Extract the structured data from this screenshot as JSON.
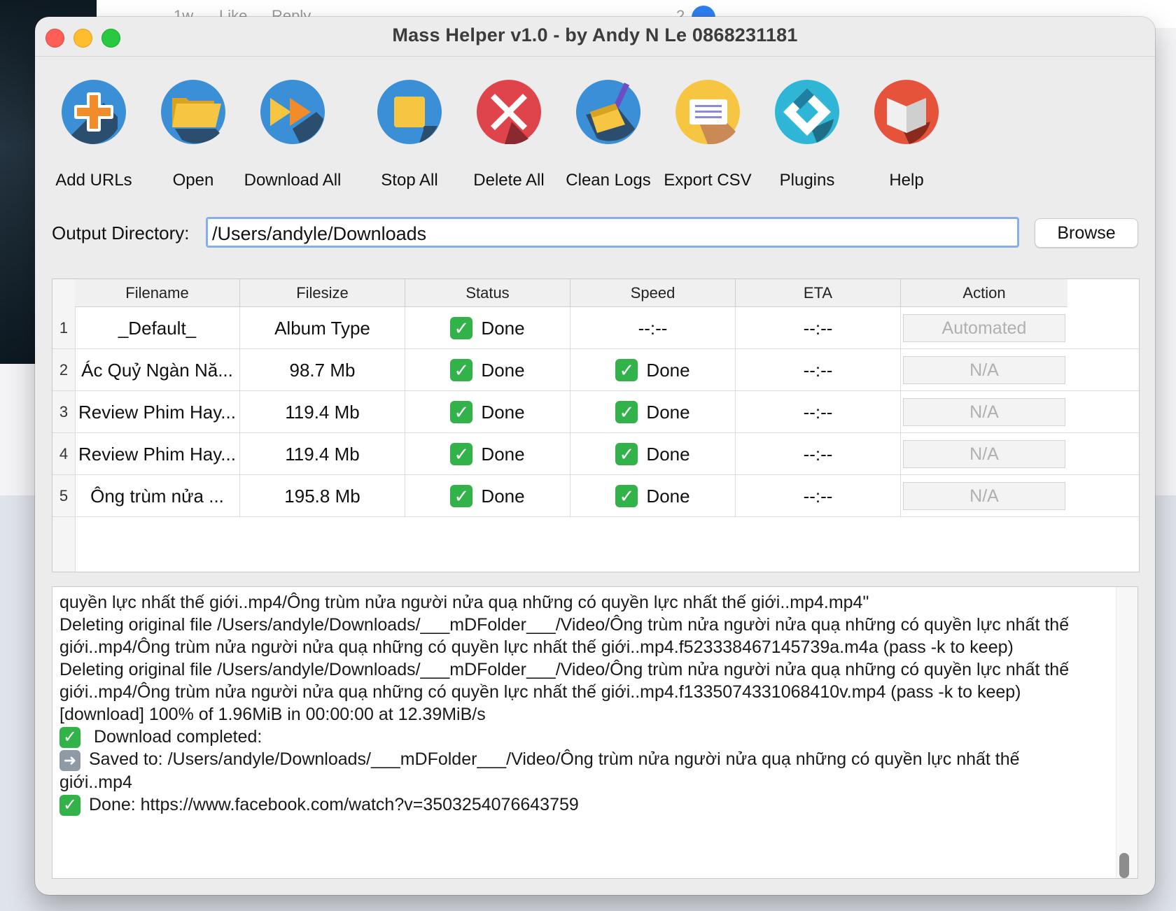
{
  "background": {
    "strip_texts": [
      "1w",
      "Like",
      "Reply",
      "2"
    ]
  },
  "window": {
    "title": "Mass Helper v1.0 - by Andy N Le 0868231181"
  },
  "toolbar": {
    "buttons": [
      {
        "label": "Add URLs",
        "icon": "add-urls-icon"
      },
      {
        "label": "Open",
        "icon": "folder-icon"
      },
      {
        "label": "Download All",
        "icon": "fast-forward-icon"
      },
      {
        "label": "Stop All",
        "icon": "stop-icon"
      },
      {
        "label": "Delete All",
        "icon": "delete-x-icon"
      },
      {
        "label": "Clean Logs",
        "icon": "broom-dustpan-icon"
      },
      {
        "label": "Export CSV",
        "icon": "document-icon"
      },
      {
        "label": "Plugins",
        "icon": "plugin-diamond-icon"
      },
      {
        "label": "Help",
        "icon": "help-book-icon"
      }
    ]
  },
  "output": {
    "label": "Output Directory:",
    "value": "/Users/andyle/Downloads",
    "browse_label": "Browse"
  },
  "table": {
    "headers": [
      "Filename",
      "Filesize",
      "Status",
      "Speed",
      "ETA",
      "Action"
    ],
    "rows": [
      {
        "num": "1",
        "filename": "_Default_",
        "filesize": "Album Type",
        "status": "Done",
        "speed": "--:--",
        "speed_done": false,
        "eta": "--:--",
        "action": "Automated"
      },
      {
        "num": "2",
        "filename": "Ác Quỷ Ngàn Nă...",
        "filesize": "98.7 Mb",
        "status": "Done",
        "speed": "Done",
        "speed_done": true,
        "eta": "--:--",
        "action": "N/A"
      },
      {
        "num": "3",
        "filename": "Review Phim Hay...",
        "filesize": "119.4 Mb",
        "status": "Done",
        "speed": "Done",
        "speed_done": true,
        "eta": "--:--",
        "action": "N/A"
      },
      {
        "num": "4",
        "filename": "Review Phim Hay...",
        "filesize": "119.4 Mb",
        "status": "Done",
        "speed": "Done",
        "speed_done": true,
        "eta": "--:--",
        "action": "N/A"
      },
      {
        "num": "5",
        "filename": "Ông trùm nửa ...",
        "filesize": "195.8 Mb",
        "status": "Done",
        "speed": "Done",
        "speed_done": true,
        "eta": "--:--",
        "action": "N/A"
      }
    ]
  },
  "log": {
    "lines": [
      {
        "text": "quyền lực nhất thế giới..mp4/Ông trùm nửa người nửa quạ những có quyền lực nhất thế giới..mp4.mp4\"",
        "prefix": ""
      },
      {
        "text": "Deleting original file /Users/andyle/Downloads/___mDFolder___/Video/Ông trùm nửa người nửa quạ những có quyền lực nhất thế giới..mp4/Ông trùm nửa người nửa quạ những có quyền lực nhất thế giới..mp4.f523338467145739a.m4a (pass -k to keep)",
        "prefix": ""
      },
      {
        "text": "Deleting original file /Users/andyle/Downloads/___mDFolder___/Video/Ông trùm nửa người nửa quạ những có quyền lực nhất thế giới..mp4/Ông trùm nửa người nửa quạ những có quyền lực nhất thế giới..mp4.f1335074331068410v.mp4 (pass -k to keep)",
        "prefix": ""
      },
      {
        "text": "[download] 100% of    1.96MiB in 00:00:00 at 12.39MiB/s",
        "prefix": ""
      },
      {
        "text": " Download completed:",
        "prefix": "check"
      },
      {
        "text": "Saved to: /Users/andyle/Downloads/___mDFolder___/Video/Ông trùm nửa người nửa quạ những có quyền lực nhất thế giới..mp4",
        "prefix": "arrow"
      },
      {
        "text": "Done: https://www.facebook.com/watch?v=3503254076643759",
        "prefix": "check"
      }
    ]
  },
  "colors": {
    "done_green": "#31b34a",
    "focus_blue": "#88aee8",
    "window_bg": "#ececec"
  }
}
